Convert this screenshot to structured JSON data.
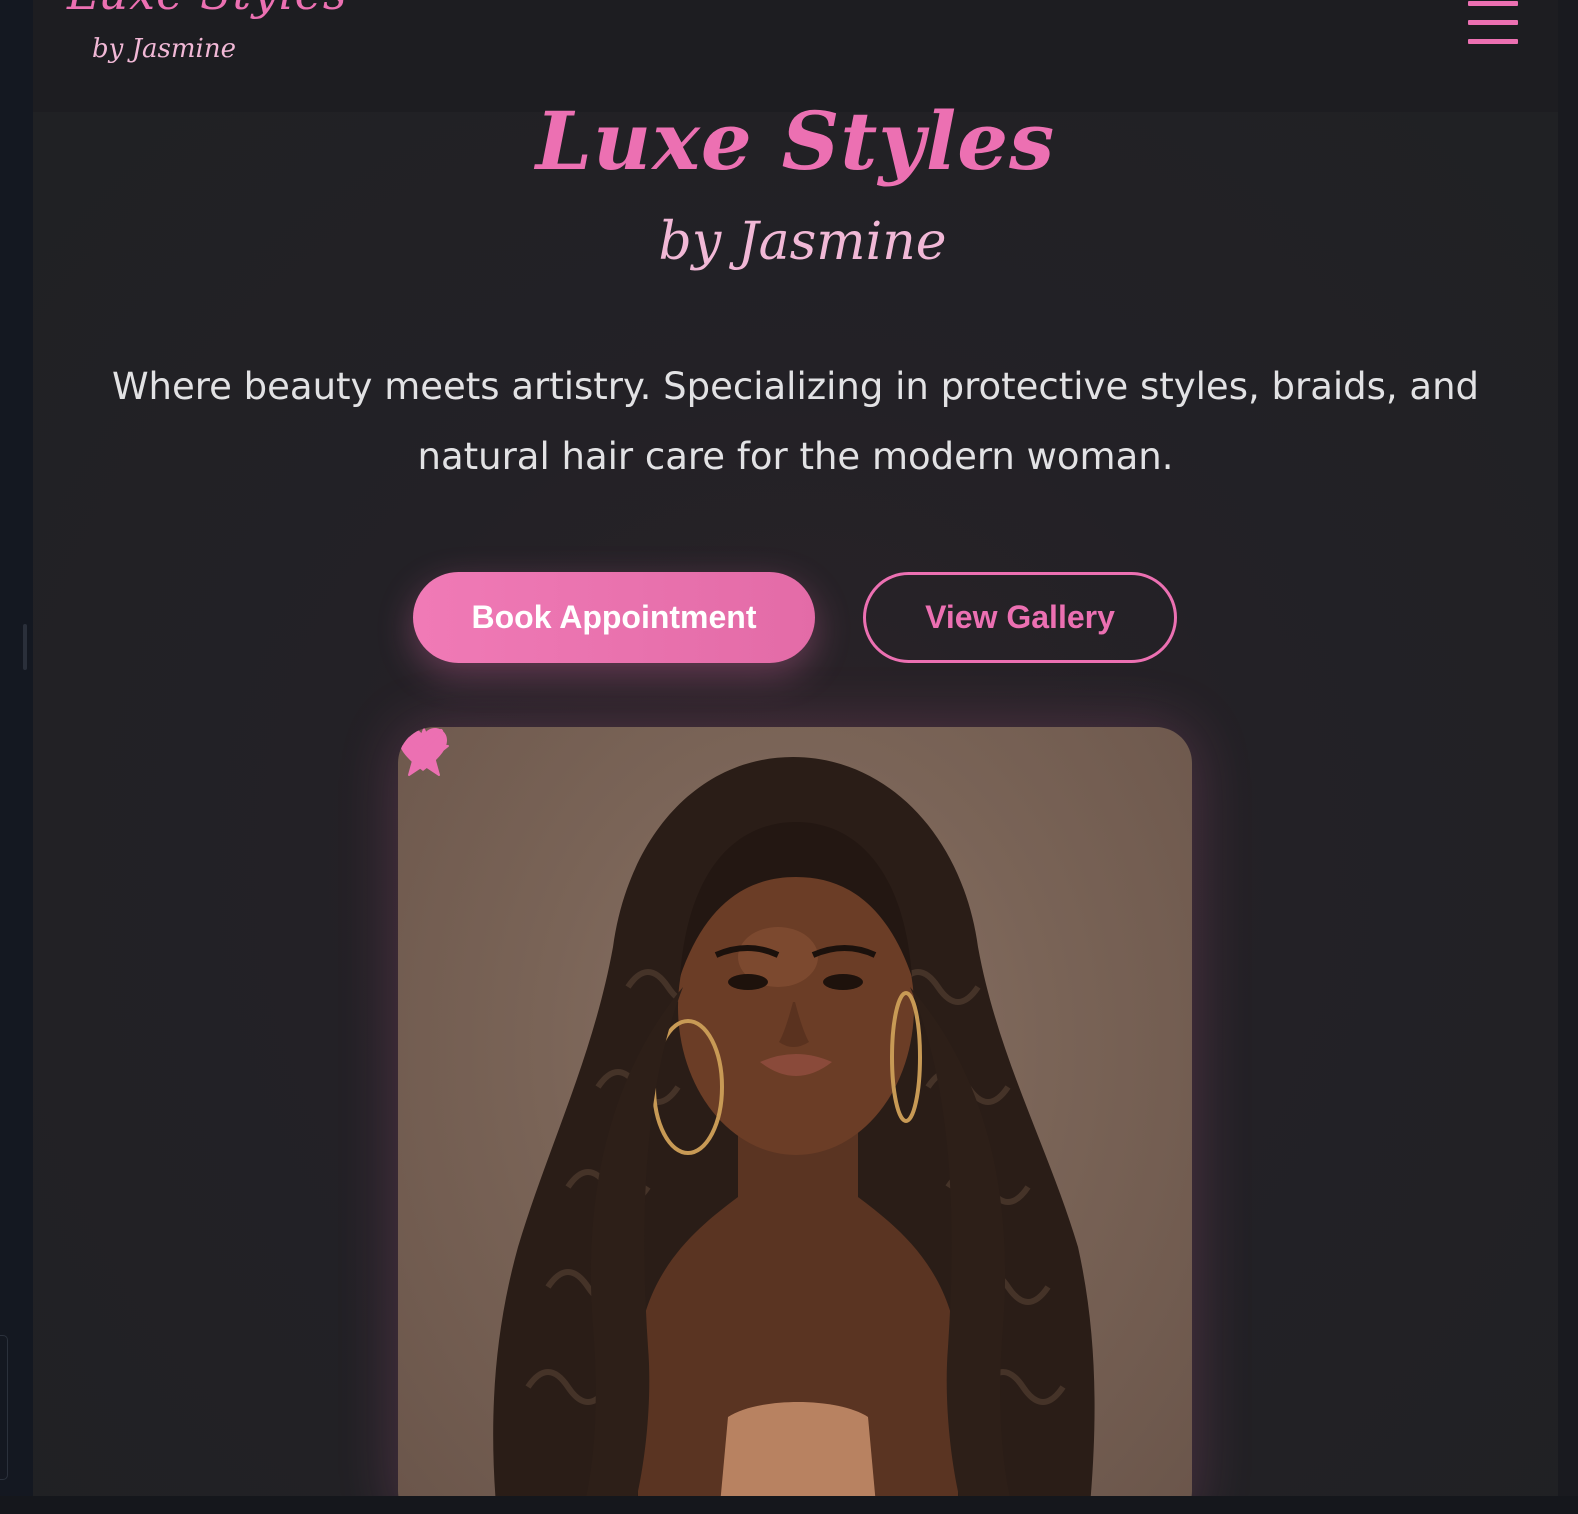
{
  "navbar": {
    "logo_main": "Luxe Styles",
    "logo_sub": "by Jasmine",
    "menu_icon": "hamburger-menu-icon"
  },
  "hero": {
    "title": "Luxe Styles",
    "subtitle": "by Jasmine",
    "tagline": "Where beauty meets artistry. Specializing in protective styles, braids, and natural hair care for the modern woman.",
    "book_label": "Book Appointment",
    "gallery_label": "View Gallery",
    "photo_icons": [
      "heart-icon",
      "star-icon",
      "chevron-down-icon"
    ]
  },
  "colors": {
    "accent_pink": "#ec70b2",
    "light_pink": "#f1b8d6",
    "background": "#222226",
    "navbar": "#1d1d21",
    "text_light": "#e2e2e4"
  }
}
